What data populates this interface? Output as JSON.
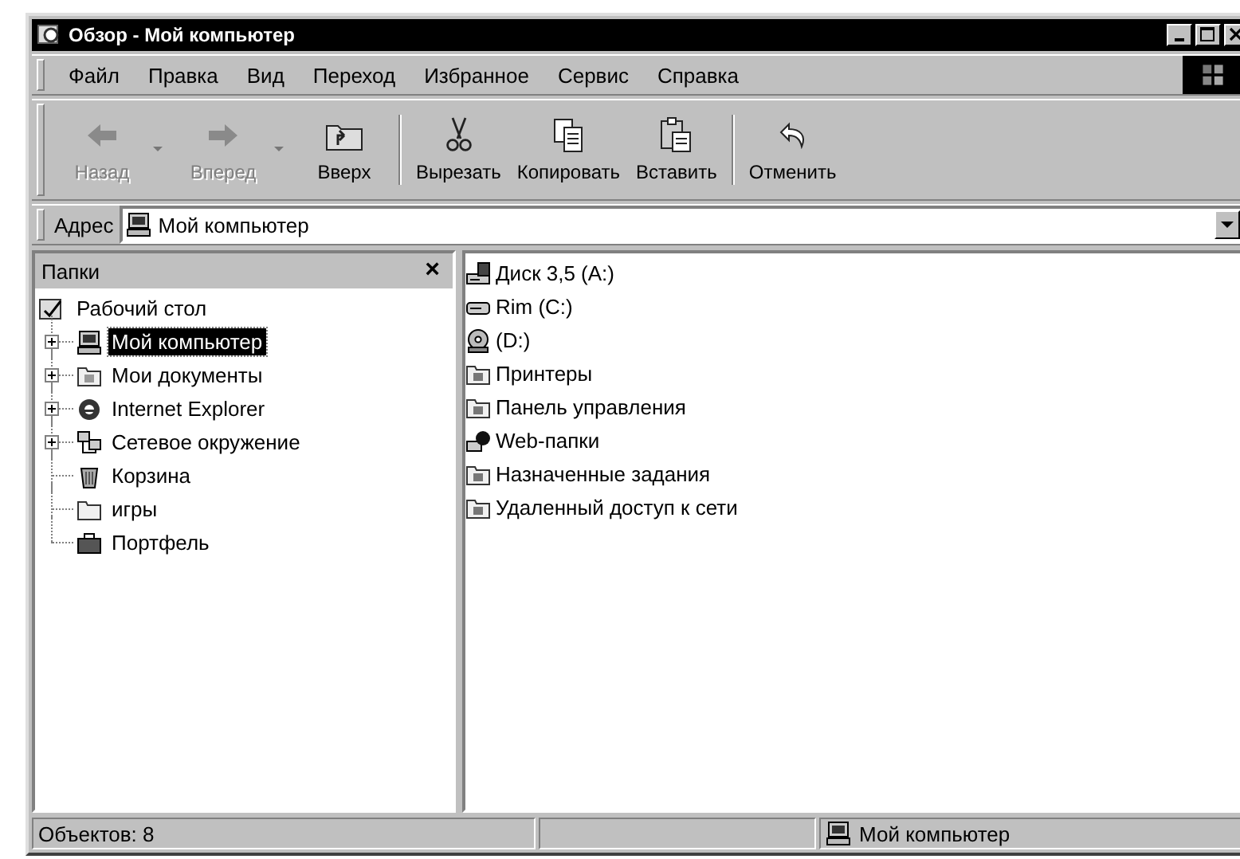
{
  "window": {
    "title": "Обзор - Мой компьютер"
  },
  "menu": [
    "Файл",
    "Правка",
    "Вид",
    "Переход",
    "Избранное",
    "Сервис",
    "Справка"
  ],
  "toolbar": {
    "groups": [
      [
        {
          "label": "Назад",
          "disabled": true,
          "dropdown": true
        },
        {
          "label": "Вперед",
          "disabled": true,
          "dropdown": true
        },
        {
          "label": "Вверх",
          "disabled": false,
          "dropdown": false
        }
      ],
      [
        {
          "label": "Вырезать",
          "disabled": false,
          "dropdown": false
        },
        {
          "label": "Копировать",
          "disabled": false,
          "dropdown": false
        },
        {
          "label": "Вставить",
          "disabled": false,
          "dropdown": false
        }
      ],
      [
        {
          "label": "Отменить",
          "disabled": false,
          "dropdown": false
        }
      ]
    ]
  },
  "address": {
    "label": "Адрес",
    "value": "Мой компьютер"
  },
  "folders": {
    "title": "Папки",
    "close": "×",
    "tree": {
      "label": "Рабочий стол",
      "selected": false,
      "children": [
        {
          "label": "Мой компьютер",
          "selected": true,
          "has_children": true
        },
        {
          "label": "Мои документы",
          "selected": false,
          "has_children": true
        },
        {
          "label": "Internet Explorer",
          "selected": false,
          "has_children": true
        },
        {
          "label": "Сетевое окружение",
          "selected": false,
          "has_children": true
        },
        {
          "label": "Корзина",
          "selected": false,
          "has_children": false
        },
        {
          "label": "игры",
          "selected": false,
          "has_children": false
        },
        {
          "label": "Портфель",
          "selected": false,
          "has_children": false
        }
      ]
    }
  },
  "items": [
    "Диск 3,5 (A:)",
    "Rim (C:)",
    "(D:)",
    "Принтеры",
    "Панель управления",
    "Web-папки",
    "Назначенные задания",
    "Удаленный доступ к сети"
  ],
  "status_bar": {
    "count": "Объектов: 8",
    "location": "Мой компьютер"
  }
}
